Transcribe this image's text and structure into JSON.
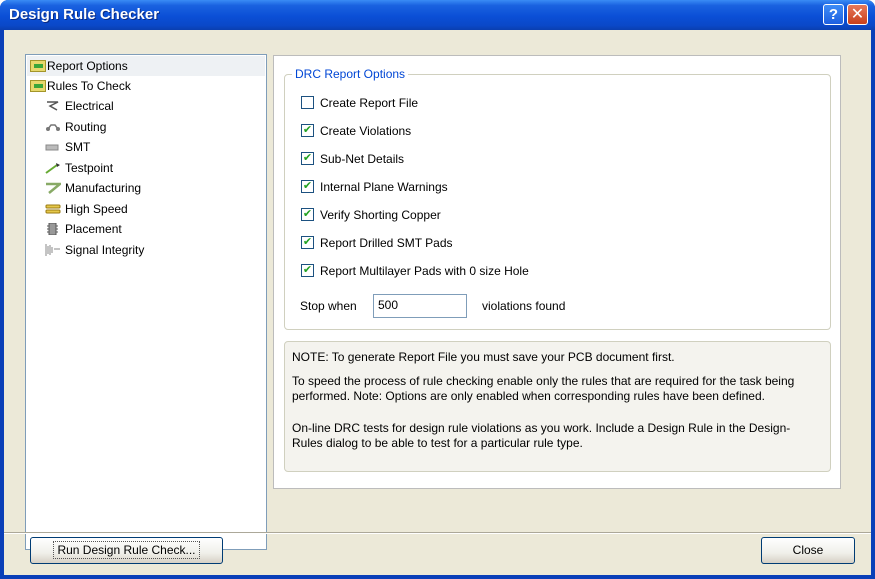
{
  "window": {
    "title": "Design Rule Checker",
    "help_glyph": "?",
    "close_glyph": "✕"
  },
  "tree": {
    "items": [
      {
        "label": "Report Options",
        "icon": "folder-icon",
        "selected": true
      },
      {
        "label": "Rules To Check",
        "icon": "folder-icon",
        "selected": false
      },
      {
        "label": "Electrical",
        "icon": "electrical-icon"
      },
      {
        "label": "Routing",
        "icon": "routing-icon"
      },
      {
        "label": "SMT",
        "icon": "smt-icon"
      },
      {
        "label": "Testpoint",
        "icon": "testpoint-icon"
      },
      {
        "label": "Manufacturing",
        "icon": "manufacturing-icon"
      },
      {
        "label": "High Speed",
        "icon": "high-speed-icon"
      },
      {
        "label": "Placement",
        "icon": "placement-icon"
      },
      {
        "label": "Signal Integrity",
        "icon": "signal-integrity-icon"
      }
    ]
  },
  "options": {
    "group_title": "DRC Report Options",
    "checkboxes": [
      {
        "label": "Create Report File",
        "checked": false
      },
      {
        "label": "Create Violations",
        "checked": true
      },
      {
        "label": "Sub-Net Details",
        "checked": true
      },
      {
        "label": "Internal Plane Warnings",
        "checked": true
      },
      {
        "label": "Verify Shorting Copper",
        "checked": true
      },
      {
        "label": "Report Drilled SMT Pads",
        "checked": true
      },
      {
        "label": "Report Multilayer Pads with 0 size Hole",
        "checked": true
      }
    ],
    "stop_label": "Stop when",
    "stop_value": "500",
    "stop_suffix": "violations found"
  },
  "notes": {
    "note1": "NOTE: To generate Report File you must save your PCB document first.",
    "note2": "To speed the process of rule checking enable only the rules that are required for the task being performed.  Note: Options are only enabled when corresponding rules have been defined.",
    "note3": "On-line DRC tests for design rule violations as you work. Include a Design Rule in the Design-Rules dialog to be able to test for a particular rule  type."
  },
  "buttons": {
    "run": "Run Design Rule Check...",
    "close": "Close"
  },
  "check_glyph": "✔"
}
